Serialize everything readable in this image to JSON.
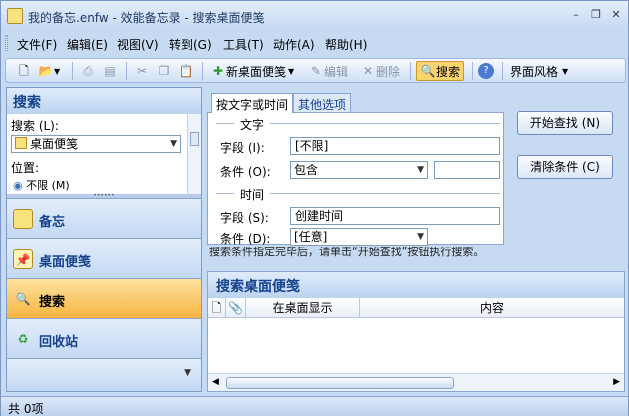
{
  "window": {
    "title": "我的备忘.enfw - 效能备忘录 - 搜索桌面便笺",
    "buttons": {
      "minimize": "–",
      "restore": "❐",
      "close": "✕"
    }
  },
  "menu": [
    "文件(F)",
    "编辑(E)",
    "视图(V)",
    "转到(G)",
    "工具(T)",
    "动作(A)",
    "帮助(H)"
  ],
  "toolbar": {
    "new_note": "新桌面便笺",
    "edit": "编辑",
    "delete": "删除",
    "search": "搜索",
    "theme": "界面风格"
  },
  "left": {
    "header": "搜索",
    "search_label": "搜索 (L):",
    "search_value": "桌面便笺",
    "location_label": "位置:",
    "location_value": "不限 (M)",
    "nav": [
      {
        "label": "备忘"
      },
      {
        "label": "桌面便笺"
      },
      {
        "label": "搜索"
      },
      {
        "label": "回收站"
      }
    ]
  },
  "right": {
    "tabs": [
      "按文字或时间",
      "其他选项"
    ],
    "group_text": "文字",
    "group_time": "时间",
    "field_label": "字段 (I):",
    "field_value": "[不限]",
    "cond_label": "条件 (O):",
    "cond_value": "包含",
    "field2_label": "字段 (S):",
    "field2_value": "创建时间",
    "cond2_label": "条件 (D):",
    "cond2_value": "[任意]",
    "btn_start": "开始查找 (N)",
    "btn_clear": "清除条件 (C)",
    "hint": "搜索条件指定完毕后，请单击“开始查找”按钮执行搜索。",
    "results_title": "搜索桌面便笺",
    "columns": [
      "在桌面显示",
      "内容"
    ]
  },
  "status": "共 0项",
  "colors": {
    "accent": "#15428b",
    "active_nav": "#f8b440",
    "frame": "#c6daf1"
  }
}
